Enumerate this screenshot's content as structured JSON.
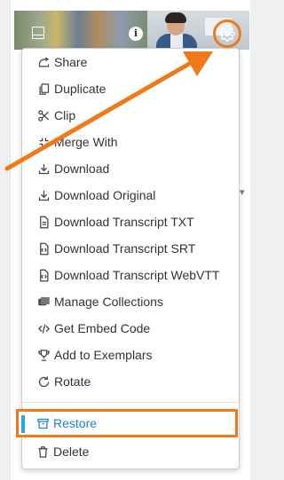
{
  "colors": {
    "accent_orange": "#f07a1a",
    "restore_blue": "#1b86c4",
    "restore_bar": "#2aa8de"
  },
  "thumb": {
    "info_icon": "info-icon",
    "settings_icon": "gear-icon",
    "info_glyph": "i"
  },
  "menu": {
    "items": [
      {
        "label": "Share",
        "icon": "share-icon"
      },
      {
        "label": "Duplicate",
        "icon": "duplicate-icon"
      },
      {
        "label": "Clip",
        "icon": "scissors-icon"
      },
      {
        "label": "Merge With",
        "icon": "merge-icon"
      },
      {
        "label": "Download",
        "icon": "download-icon"
      },
      {
        "label": "Download Original",
        "icon": "download-icon"
      },
      {
        "label": "Download Transcript TXT",
        "icon": "file-icon"
      },
      {
        "label": "Download Transcript SRT",
        "icon": "file-code-icon"
      },
      {
        "label": "Download Transcript WebVTT",
        "icon": "file-code-icon"
      },
      {
        "label": "Manage Collections",
        "icon": "collections-icon"
      },
      {
        "label": "Get Embed Code",
        "icon": "code-icon"
      },
      {
        "label": "Add to Exemplars",
        "icon": "trophy-icon"
      },
      {
        "label": "Rotate",
        "icon": "rotate-icon"
      }
    ],
    "restore": {
      "label": "Restore",
      "icon": "archive-icon"
    },
    "delete": {
      "label": "Delete",
      "icon": "trash-icon"
    }
  }
}
